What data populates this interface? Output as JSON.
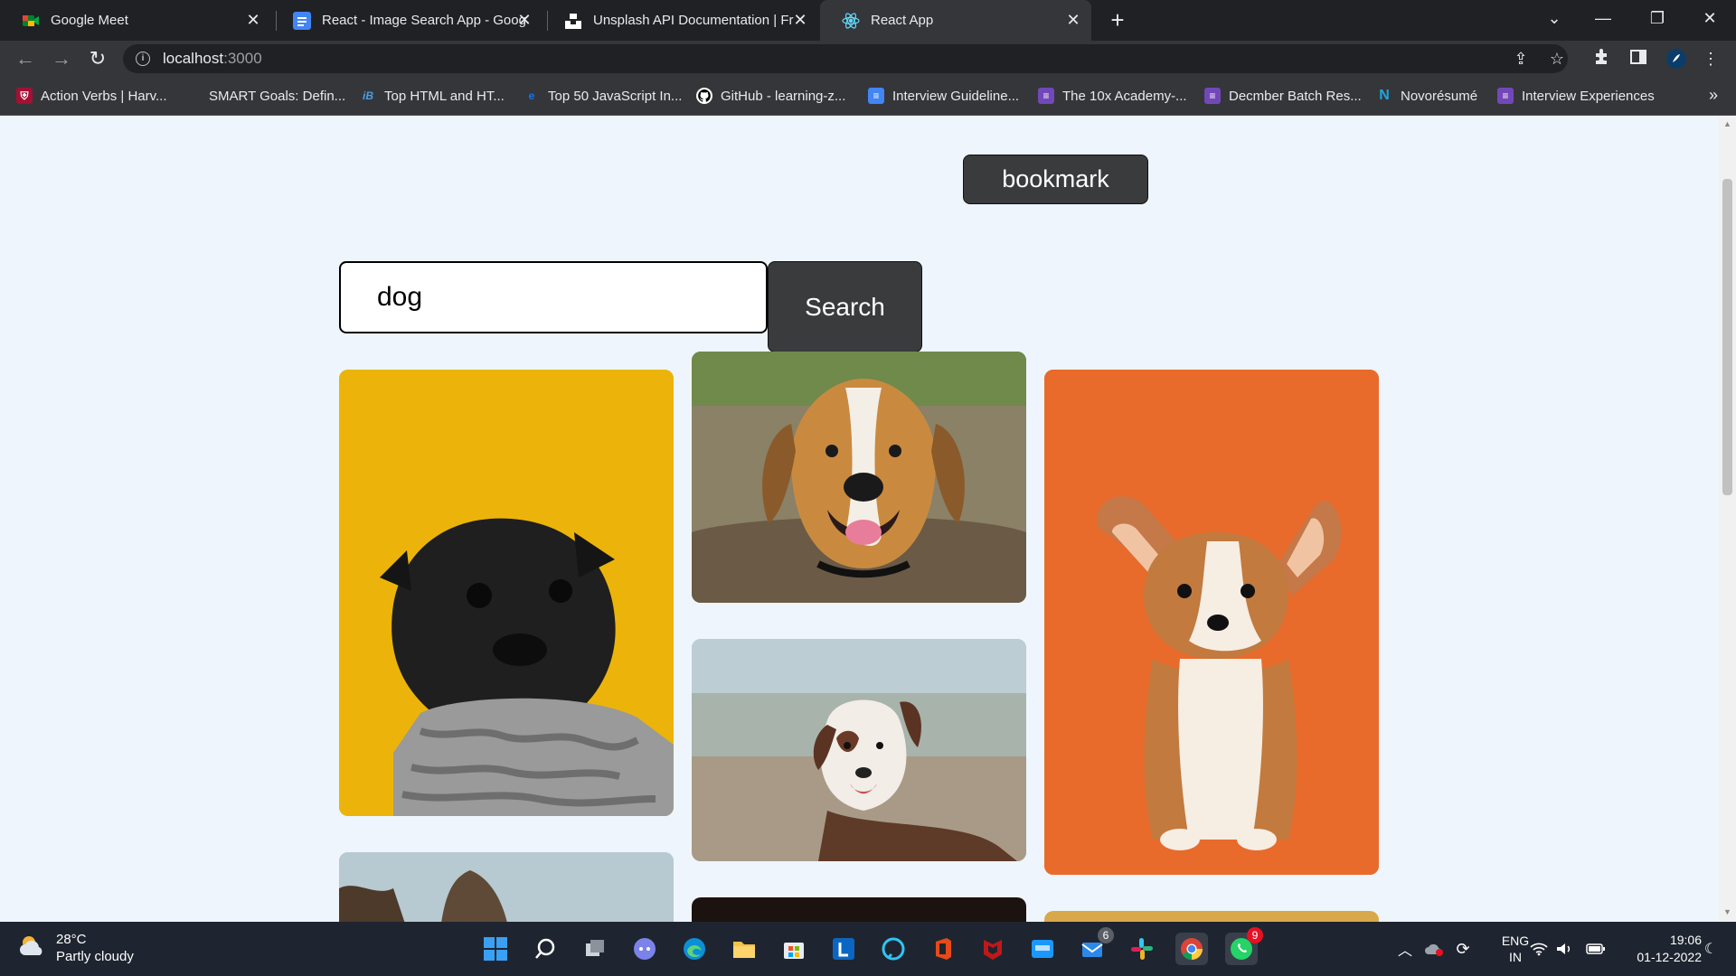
{
  "browser": {
    "tabs": [
      {
        "title": "Google Meet",
        "active": false
      },
      {
        "title": "React - Image Search App - Goog",
        "active": false
      },
      {
        "title": "Unsplash API Documentation | Fr",
        "active": false
      },
      {
        "title": "React App",
        "active": true
      }
    ],
    "tab_close": "✕",
    "new_tab": "+",
    "window_controls": {
      "tab_search": "⌄",
      "minimize": "—",
      "restore": "❐",
      "close": "✕"
    },
    "url_host": "localhost",
    "url_port": ":3000",
    "bookmarks": [
      "Action Verbs | Harv...",
      "SMART Goals: Defin...",
      "Top HTML and HT...",
      "Top 50 JavaScript In...",
      "GitHub - learning-z...",
      "Interview Guideline...",
      "The 10x Academy-...",
      "Decmber Batch Res...",
      "Novorésumé",
      "Interview Experiences"
    ],
    "bookmarks_more": "»"
  },
  "app": {
    "bookmark_label": "bookmark",
    "search_value": "dog",
    "search_label": "Search"
  },
  "taskbar": {
    "temperature": "28°C",
    "weather": "Partly cloudy",
    "language": "ENG",
    "region": "IN",
    "time": "19:06",
    "date": "01-12-2022",
    "teams_badge": "6",
    "whatsapp_badge": "9"
  }
}
